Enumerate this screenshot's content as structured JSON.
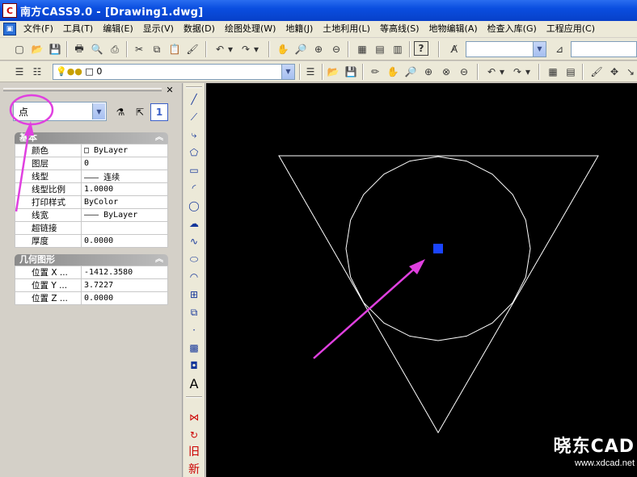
{
  "window": {
    "title": "南方CASS9.0 - [Drawing1.dwg]",
    "app_icon": "C"
  },
  "menu": {
    "items": [
      "文件(F)",
      "工具(T)",
      "编辑(E)",
      "显示(V)",
      "数据(D)",
      "绘图处理(W)",
      "地籍(J)",
      "土地利用(L)",
      "等高线(S)",
      "地物编辑(A)",
      "检查入库(G)",
      "工程应用(C)"
    ]
  },
  "toolbar2": {
    "layer_value": "0"
  },
  "properties": {
    "object_type": "点",
    "basic": {
      "title": "基本",
      "rows": [
        {
          "key": "颜色",
          "value": "□ ByLayer"
        },
        {
          "key": "图层",
          "value": "0"
        },
        {
          "key": "线型",
          "value": "——— 连续"
        },
        {
          "key": "线型比例",
          "value": "1.0000"
        },
        {
          "key": "打印样式",
          "value": "ByColor"
        },
        {
          "key": "线宽",
          "value": "——— ByLayer"
        },
        {
          "key": "超链接",
          "value": ""
        },
        {
          "key": "厚度",
          "value": "0.0000"
        }
      ]
    },
    "geometry": {
      "title": "几何图形",
      "rows": [
        {
          "key": "位置 X ...",
          "value": "-1412.3580"
        },
        {
          "key": "位置 Y ...",
          "value": "3.7227"
        },
        {
          "key": "位置 Z ...",
          "value": "0.0000"
        }
      ]
    }
  },
  "side_toolbar": {
    "text_tool": "A",
    "old_label": "旧",
    "new_label": "新"
  },
  "watermark": {
    "brand": "晓东CAD",
    "url": "www.xdcad.net"
  },
  "colors": {
    "title_bar": "#0a4ee0",
    "canvas": "#000000",
    "point_marker": "#1a44ff",
    "annotation": "#e040e0"
  }
}
